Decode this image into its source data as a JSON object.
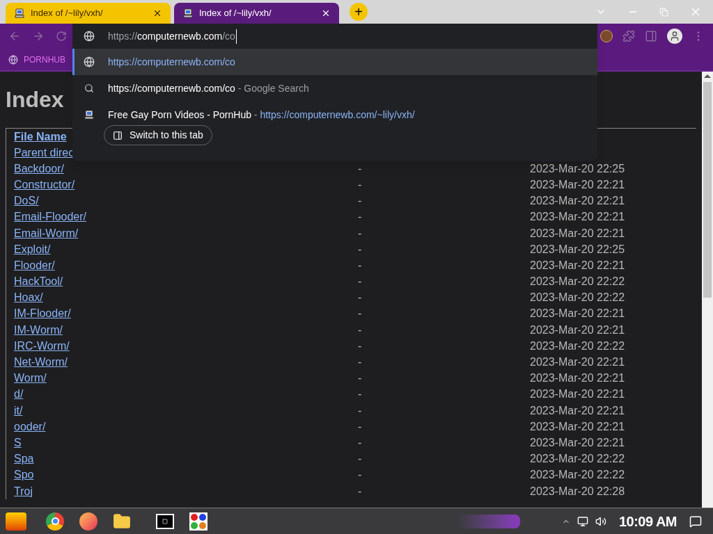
{
  "tabs": [
    {
      "title": "Index of /~lily/vxh/",
      "selected": false
    },
    {
      "title": "Index of /~lily/vxh/",
      "selected": true
    }
  ],
  "new_tab": "+",
  "omnibox": {
    "scheme": "https://",
    "host": "computernewb.com",
    "path": "/co"
  },
  "suggestions": [
    {
      "kind": "url",
      "text": "https://computernewb.com/co",
      "selected": true
    },
    {
      "kind": "search",
      "text": "https://computernewb.com/co",
      "hint": "- Google Search",
      "selected": false
    },
    {
      "kind": "tab",
      "text": "Free Gay Porn Videos - PornHub",
      "separator": "-",
      "url": "https://computernewb.com/~lily/vxh/",
      "action": "Switch to this tab",
      "selected": false
    }
  ],
  "bookmarks": [
    {
      "label": "PORNHUB"
    }
  ],
  "page": {
    "heading": "Index",
    "columns": [
      "File Name"
    ],
    "rows": [
      {
        "name": "Parent direc"
      },
      {
        "name": "Backdoor/",
        "size": "-",
        "date": "2023-Mar-20 22:25"
      },
      {
        "name": "Constructor/",
        "size": "-",
        "date": "2023-Mar-20 22:21"
      },
      {
        "name": "DoS/",
        "size": "-",
        "date": "2023-Mar-20 22:21"
      },
      {
        "name": "Email-Flooder/",
        "size": "-",
        "date": "2023-Mar-20 22:21"
      },
      {
        "name": "Email-Worm/",
        "size": "-",
        "date": "2023-Mar-20 22:21"
      },
      {
        "name": "Exploit/",
        "size": "-",
        "date": "2023-Mar-20 22:25"
      },
      {
        "name": "Flooder/",
        "size": "-",
        "date": "2023-Mar-20 22:21"
      },
      {
        "name": "HackTool/",
        "size": "-",
        "date": "2023-Mar-20 22:22"
      },
      {
        "name": "Hoax/",
        "size": "-",
        "date": "2023-Mar-20 22:22"
      },
      {
        "name": "IM-Flooder/",
        "size": "-",
        "date": "2023-Mar-20 22:21"
      },
      {
        "name": "IM-Worm/",
        "size": "-",
        "date": "2023-Mar-20 22:21"
      },
      {
        "name": "IRC-Worm/",
        "size": "-",
        "date": "2023-Mar-20 22:22"
      },
      {
        "name": "Net-Worm/",
        "size": "-",
        "date": "2023-Mar-20 22:21"
      },
      {
        "name": "Worm/",
        "size": "-",
        "date": "2023-Mar-20 22:21"
      },
      {
        "name": "d/",
        "size": "-",
        "date": "2023-Mar-20 22:21"
      },
      {
        "name": "it/",
        "size": "-",
        "date": "2023-Mar-20 22:21"
      },
      {
        "name": "ooder/",
        "size": "-",
        "date": "2023-Mar-20 22:21"
      },
      {
        "name": "S",
        "size": "-",
        "date": "2023-Mar-20 22:21"
      },
      {
        "name": "Spa",
        "size": "-",
        "date": "2023-Mar-20 22:22"
      },
      {
        "name": "Spo",
        "size": "-",
        "date": "2023-Mar-20 22:22"
      },
      {
        "name": "Troj",
        "size": "-",
        "date": "2023-Mar-20 22:28"
      }
    ]
  },
  "taskbar": {
    "clock": "10:09 AM"
  }
}
